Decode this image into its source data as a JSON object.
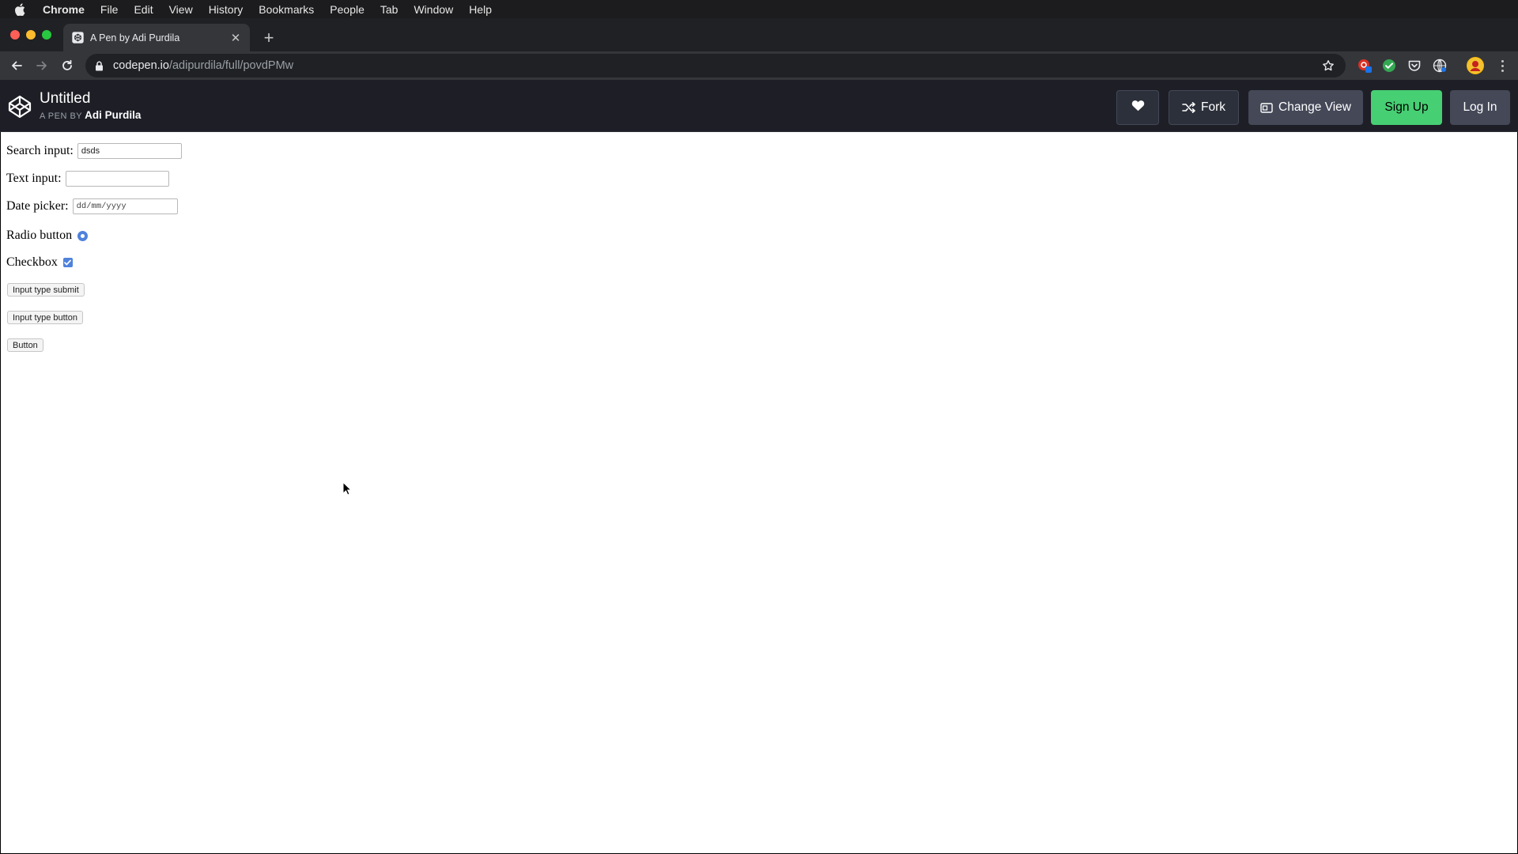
{
  "menubar": {
    "app": "Chrome",
    "items": [
      "File",
      "Edit",
      "View",
      "History",
      "Bookmarks",
      "People",
      "Tab",
      "Window",
      "Help"
    ]
  },
  "browser": {
    "tab_title": "A Pen by Adi Purdila",
    "url_host": "codepen.io",
    "url_path": "/adipurdila/full/povdPMw"
  },
  "codepen": {
    "title": "Untitled",
    "by_label": "A PEN BY",
    "author": "Adi Purdila",
    "fork_label": "Fork",
    "change_view_label": "Change View",
    "signup_label": "Sign Up",
    "login_label": "Log In",
    "colors": {
      "signup_green": "#47cf73",
      "header_bg": "#1e1f26"
    }
  },
  "form": {
    "search_label": "Search input:",
    "search_value": "dsds",
    "text_label": "Text input:",
    "text_value": "",
    "date_label": "Date picker:",
    "date_placeholder": "dd/mm/yyyy",
    "radio_label": "Radio button",
    "radio_checked": true,
    "checkbox_label": "Checkbox",
    "checkbox_checked": true,
    "submit_label": "Input type submit",
    "input_button_label": "Input type button",
    "button_label": "Button",
    "accent": "#4f82dc"
  }
}
